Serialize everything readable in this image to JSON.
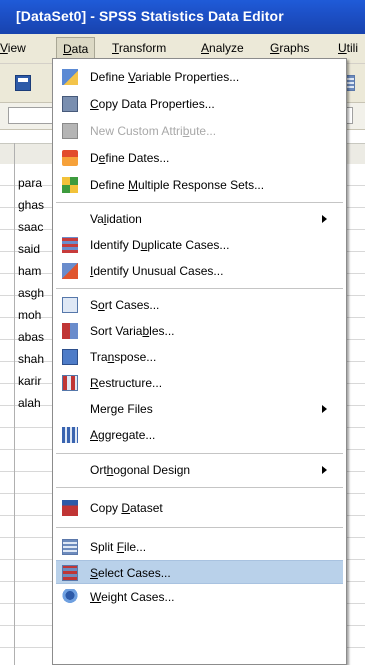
{
  "window": {
    "title": "[DataSet0] - SPSS Statistics Data Editor"
  },
  "menubar": [
    {
      "label": "View",
      "pre": "",
      "u": "V",
      "post": "iew",
      "partial": true
    },
    {
      "label": "Data",
      "pre": "",
      "u": "D",
      "post": "ata"
    },
    {
      "label": "Transform",
      "pre": "",
      "u": "T",
      "post": "ransform"
    },
    {
      "label": "Analyze",
      "pre": "",
      "u": "A",
      "post": "nalyze"
    },
    {
      "label": "Graphs",
      "pre": "",
      "u": "G",
      "post": "raphs"
    },
    {
      "label": "Utilities",
      "pre": "",
      "u": "U",
      "post": "tili"
    }
  ],
  "grid": {
    "rows": [
      "para",
      "ghas",
      "saac",
      "said",
      "ham",
      "asgh",
      "moh",
      "abas",
      "shah",
      "karir",
      "alah"
    ]
  },
  "data_menu": {
    "items": [
      {
        "pre": "Define ",
        "u": "V",
        "post": "ariable Properties...",
        "icon": "variable-properties-icon"
      },
      {
        "pre": "",
        "u": "C",
        "post": "opy Data Properties...",
        "icon": "copy-data-properties-icon"
      },
      {
        "pre": "New Custom Attri",
        "u": "b",
        "post": "ute...",
        "icon": "custom-attribute-icon",
        "disabled": true
      },
      {
        "pre": "D",
        "u": "e",
        "post": "fine Dates...",
        "icon": "define-dates-icon"
      },
      {
        "pre": "Define ",
        "u": "M",
        "post": "ultiple Response Sets...",
        "icon": "multiple-response-icon"
      },
      {
        "pre": "Va",
        "u": "l",
        "post": "idation",
        "submenu": true
      },
      {
        "pre": "Identify D",
        "u": "u",
        "post": "plicate Cases...",
        "icon": "duplicate-cases-icon"
      },
      {
        "pre": "",
        "u": "I",
        "post": "dentify Unusual Cases...",
        "icon": "unusual-cases-icon"
      },
      {
        "pre": "S",
        "u": "o",
        "post": "rt Cases...",
        "icon": "sort-cases-icon"
      },
      {
        "pre": "Sort Varia",
        "u": "b",
        "post": "les...",
        "icon": "sort-variables-icon"
      },
      {
        "pre": "Tra",
        "u": "n",
        "post": "spose...",
        "icon": "transpose-icon"
      },
      {
        "pre": "",
        "u": "R",
        "post": "estructure...",
        "icon": "restructure-icon"
      },
      {
        "pre": "Mer",
        "u": "g",
        "post": "e Files",
        "submenu": true
      },
      {
        "pre": "",
        "u": "A",
        "post": "ggregate...",
        "icon": "aggregate-icon"
      },
      {
        "pre": "Ort",
        "u": "h",
        "post": "ogonal Design",
        "submenu": true
      },
      {
        "pre": "Copy ",
        "u": "D",
        "post": "ataset",
        "icon": "copy-dataset-icon"
      },
      {
        "pre": "Split ",
        "u": "F",
        "post": "ile...",
        "icon": "split-file-icon"
      },
      {
        "pre": "",
        "u": "S",
        "post": "elect Cases...",
        "icon": "select-cases-icon",
        "selected": true
      },
      {
        "pre": "",
        "u": "W",
        "post": "eight Cases...",
        "icon": "weight-cases-icon"
      }
    ]
  },
  "colors": {
    "titlebar": "#1c4fc5",
    "menubar": "#ece9d8",
    "selection": "#b9d1ea"
  }
}
